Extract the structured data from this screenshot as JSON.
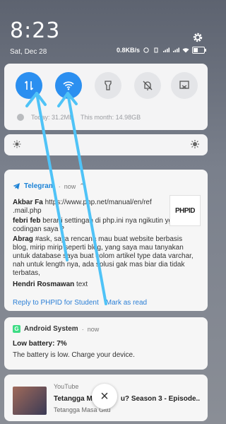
{
  "status": {
    "time": "8:23",
    "date": "Sat, Dec 28",
    "net_speed": "0.8KB/s"
  },
  "quick_settings": {
    "today": "Today: 31.2MB",
    "month": "This month: 14.98GB"
  },
  "telegram": {
    "app": "Telegram",
    "time": "now",
    "messages": [
      {
        "sender": "Akbar Fa",
        "text": "https://www.php.net/manual/en/ref"
      },
      {
        "sender": "",
        "text": ".mail.php"
      },
      {
        "sender": "febri feb",
        "text": "berarti settingan di php.ini nya ngikutin yg"
      },
      {
        "sender": "",
        "text": "codingan saya ?"
      },
      {
        "sender": "Abrag",
        "text": "#ask, saya rencana mau buat website berbasis"
      },
      {
        "sender": "",
        "text": "blog, mirip mirip seperti blog, yang saya mau tanyakan"
      },
      {
        "sender": "",
        "text": "untuk database saya buat colom artikel type data varchar,"
      },
      {
        "sender": "",
        "text": "nah untuk length nya, ada solusi gak mas biar dia tidak"
      },
      {
        "sender": "",
        "text": "terbatas,"
      },
      {
        "sender": "Hendri Rosmawan",
        "text": "text"
      }
    ],
    "thumb_label": "PHPID",
    "reply_action": "Reply to PHPID for Student",
    "read_action": "Mark as read"
  },
  "android_system": {
    "app": "Android System",
    "time": "now",
    "title": "Low battery: 7%",
    "body": "The battery is low. Charge your device."
  },
  "youtube": {
    "app": "YouTube",
    "title": "Tetangga M",
    "title_tail": "u? Season 3 - Episode..",
    "subtitle": "Tetangga Masa Gitu"
  },
  "colors": {
    "accent": "#2b8ff0",
    "arrow": "#4fc3f7"
  }
}
